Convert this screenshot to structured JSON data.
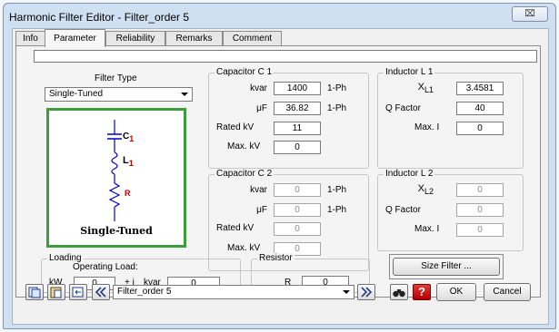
{
  "window": {
    "title": "Harmonic Filter Editor - Filter_order 5",
    "close_glyph": "⌧"
  },
  "tabs": [
    {
      "label": "Info"
    },
    {
      "label": "Parameter",
      "active": true
    },
    {
      "label": "Reliability"
    },
    {
      "label": "Remarks"
    },
    {
      "label": "Comment"
    }
  ],
  "filter_type": {
    "label": "Filter Type",
    "selected": "Single-Tuned",
    "diagram_caption": "Single-Tuned",
    "diagram_labels": {
      "c": "C",
      "c_sub": "1",
      "l": "L",
      "l_sub": "1",
      "r": "R"
    }
  },
  "capacitor_c1": {
    "title": "Capacitor C 1",
    "kvar_label": "kvar",
    "kvar_value": "1400",
    "kvar_unit": "1-Ph",
    "uf_label": "μF",
    "uf_value": "36.82",
    "uf_unit": "1-Ph",
    "rated_kv_label": "Rated kV",
    "rated_kv_value": "11",
    "max_kv_label": "Max. kV",
    "max_kv_value": "0"
  },
  "capacitor_c2": {
    "title": "Capacitor C 2",
    "kvar_label": "kvar",
    "kvar_value": "0",
    "kvar_unit": "1-Ph",
    "uf_label": "μF",
    "uf_value": "0",
    "uf_unit": "1-Ph",
    "rated_kv_label": "Rated kV",
    "rated_kv_value": "0",
    "max_kv_label": "Max. kV",
    "max_kv_value": "0"
  },
  "inductor_l1": {
    "title": "Inductor L 1",
    "xl_label": "X",
    "xl_sub": "L1",
    "xl_value": "3.4581",
    "q_label": "Q Factor",
    "q_value": "40",
    "max_i_label": "Max. I",
    "max_i_value": "0"
  },
  "inductor_l2": {
    "title": "Inductor L 2",
    "xl_label": "X",
    "xl_sub": "L2",
    "xl_value": "0",
    "q_label": "Q Factor",
    "q_value": "0",
    "max_i_label": "Max. I",
    "max_i_value": "0"
  },
  "loading": {
    "title": "Loading",
    "subtitle": "Operating Load:",
    "kw_label": "kW",
    "kw_value": "0",
    "plus_j": "+ j",
    "kvar_label": "kvar",
    "kvar_value": "0"
  },
  "resistor": {
    "title": "Resistor",
    "r_label": "R",
    "r_value": "0"
  },
  "size_filter_button": "Size Filter ...",
  "bottom_bar": {
    "filter_select": "Filter_order 5",
    "ok_label": "OK",
    "cancel_label": "Cancel",
    "help_glyph": "?"
  },
  "colors": {
    "diagram_border": "#3b9d3b",
    "symbol_red": "#c00000",
    "symbol_blue": "#0000cc",
    "help_red": "#d40000"
  }
}
